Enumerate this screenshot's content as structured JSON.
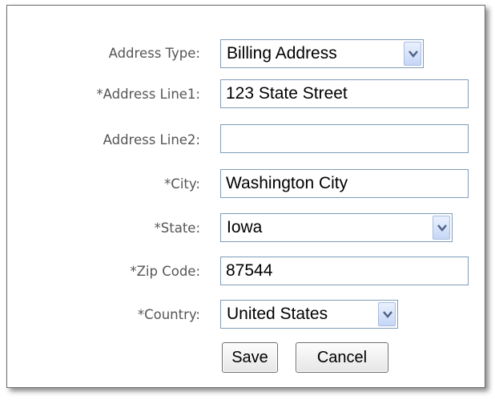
{
  "form": {
    "address_type": {
      "label": "Address Type:",
      "value": "Billing Address"
    },
    "address_line1": {
      "label": "*Address Line1:",
      "value": "123 State Street"
    },
    "address_line2": {
      "label": "Address Line2:",
      "value": ""
    },
    "city": {
      "label": "*City:",
      "value": "Washington City"
    },
    "state": {
      "label": "*State:",
      "value": "Iowa"
    },
    "zip_code": {
      "label": "*Zip Code:",
      "value": "87544"
    },
    "country": {
      "label": "*Country:",
      "value": "United States"
    }
  },
  "buttons": {
    "save": "Save",
    "cancel": "Cancel"
  },
  "icons": {
    "dropdown": "chevron-down-icon"
  },
  "colors": {
    "label_text": "#555555",
    "field_border": "#7f9db9",
    "arrow_button": "#c5d6f6"
  }
}
